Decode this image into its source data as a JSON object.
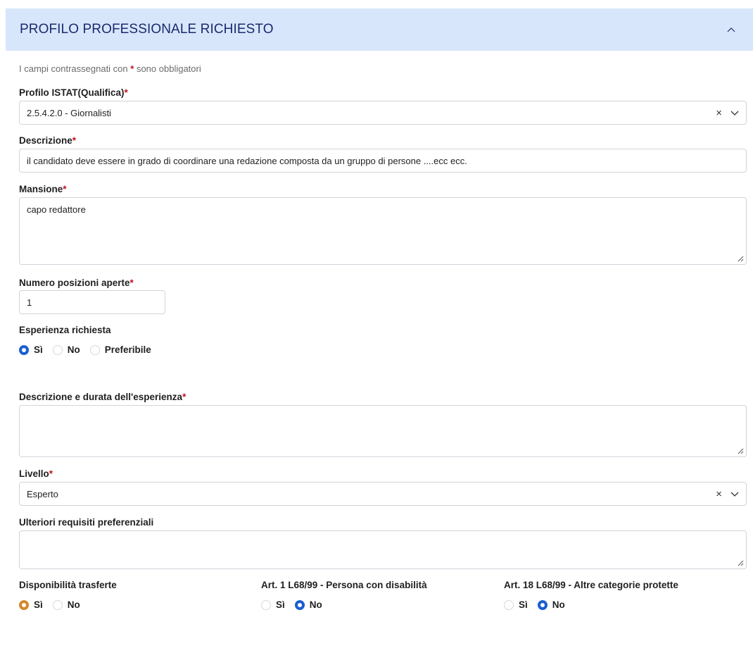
{
  "section": {
    "title": "PROFILO PROFESSIONALE RICHIESTO"
  },
  "note": {
    "prefix": "I campi contrassegnati con",
    "star": "*",
    "suffix": "sono obbligatori"
  },
  "fields": {
    "profilo": {
      "label": "Profilo ISTAT(Qualifica)",
      "value": "2.5.4.2.0 - Giornalisti"
    },
    "descrizione": {
      "label": "Descrizione",
      "value": "il candidato deve essere in grado di coordinare una redazione composta da un gruppo di persone ....ecc ecc."
    },
    "mansione": {
      "label": "Mansione",
      "value": "capo redattore"
    },
    "numero": {
      "label": "Numero posizioni aperte",
      "value": "1"
    },
    "esperienza": {
      "label": "Esperienza richiesta",
      "options": [
        "Sì",
        "No",
        "Preferibile"
      ],
      "selected": "Sì"
    },
    "descrizione_esperienza": {
      "label": "Descrizione e durata dell'esperienza",
      "value": ""
    },
    "livello": {
      "label": "Livello",
      "value": "Esperto"
    },
    "ulteriori": {
      "label": "Ulteriori requisiti preferenziali",
      "value": ""
    },
    "trasferte": {
      "label": "Disponibilità trasferte",
      "options": [
        "Sì",
        "No"
      ],
      "selected": "Sì"
    },
    "art1": {
      "label": "Art. 1 L68/99 - Persona con disabilità",
      "options": [
        "Sì",
        "No"
      ],
      "selected": "No"
    },
    "art18": {
      "label": "Art. 18 L68/99 - Altre categorie protette",
      "options": [
        "Sì",
        "No"
      ],
      "selected": "No"
    }
  },
  "required_mark": "*",
  "colors": {
    "header_bg": "#d7e6fb",
    "header_text": "#1a2a6c",
    "required": "#c0121e",
    "radio_selected": "#1a5fd1",
    "radio_selected_alt": "#d4892c"
  },
  "icons": {
    "collapse": "chevron-up-icon",
    "clear": "close-icon",
    "dropdown": "chevron-down-icon",
    "resize": "resize-handle-icon"
  }
}
